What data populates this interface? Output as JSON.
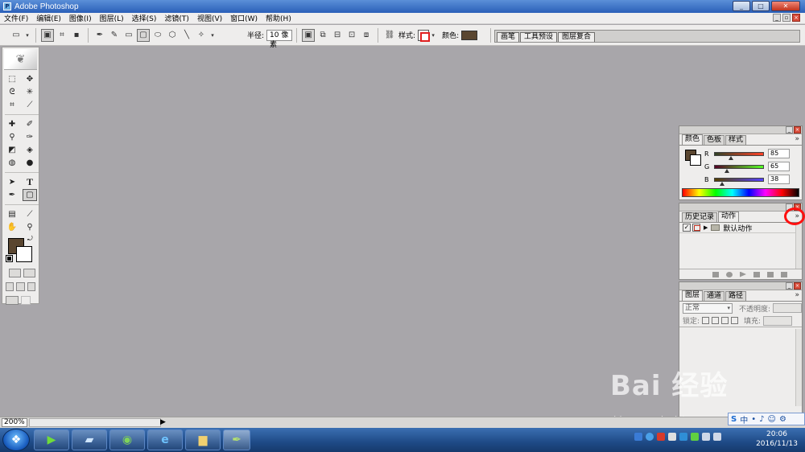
{
  "window": {
    "title": "Adobe Photoshop",
    "min": "_",
    "max": "□",
    "close": "✕"
  },
  "menu": [
    "文件(F)",
    "编辑(E)",
    "图像(I)",
    "图层(L)",
    "选择(S)",
    "滤镜(T)",
    "视图(V)",
    "窗口(W)",
    "帮助(H)"
  ],
  "options": {
    "radius_label": "半径:",
    "radius_value": "10 像素",
    "style_label": "样式:",
    "color_label": "颜色:",
    "color_hex": "#5a4630"
  },
  "palette_well": [
    "画笔",
    "工具预设",
    "图层复合"
  ],
  "colors": {
    "foreground": "#5a4630",
    "background": "#ffffff"
  },
  "color_palette": {
    "tabs": [
      "颜色",
      "色板",
      "样式"
    ],
    "channels": [
      {
        "name": "R",
        "value": "85",
        "level": 0.333,
        "gradient": "linear-gradient(to right,#2f4126,#ff4126)"
      },
      {
        "name": "G",
        "value": "65",
        "level": 0.255,
        "gradient": "linear-gradient(to right,#550026,#55ff26)"
      },
      {
        "name": "B",
        "value": "38",
        "level": 0.149,
        "gradient": "linear-gradient(to right,#554100,#5541ff)"
      }
    ]
  },
  "actions_palette": {
    "tabs": [
      "历史记录",
      "动作"
    ],
    "check": "✓",
    "menu_icon": "»",
    "items": [
      {
        "name": "默认动作"
      }
    ]
  },
  "layers_palette": {
    "tabs": [
      "图层",
      "通道",
      "路径"
    ],
    "blend_mode": "正常",
    "opacity_label": "不透明度:",
    "lock_label": "锁定:",
    "fill_label": "填充:"
  },
  "status": {
    "zoom": "200%"
  },
  "taskbar": {
    "time": "20:06",
    "date": "2016/11/13"
  },
  "watermark": {
    "text": "Bai 经验",
    "sub": "jingyan.baidu.com"
  },
  "ime": {
    "lang": "中"
  }
}
